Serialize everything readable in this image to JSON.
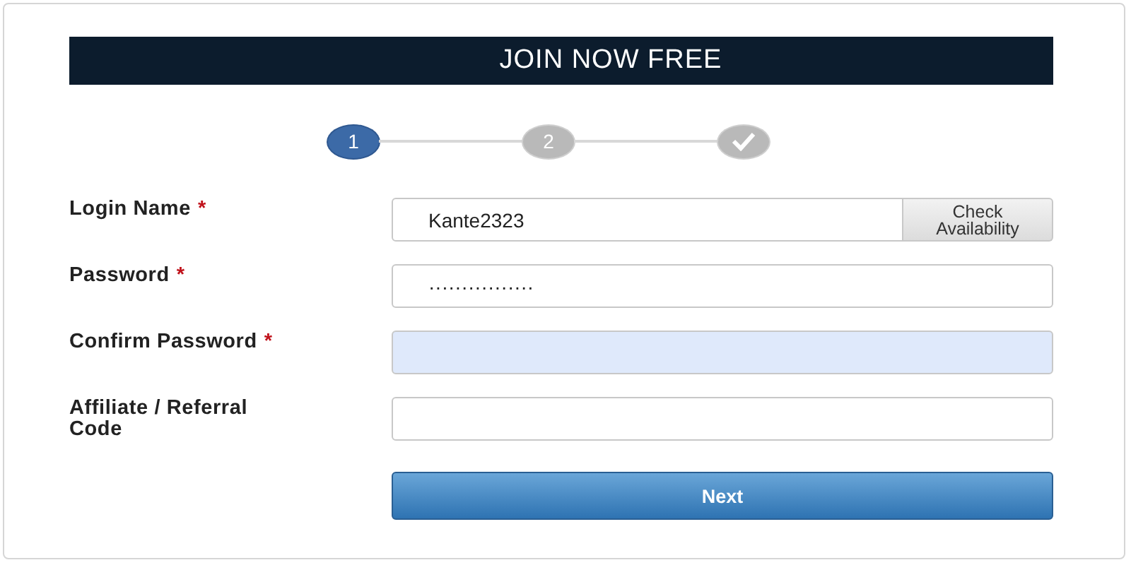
{
  "header": {
    "title": "JOIN NOW FREE"
  },
  "steps": [
    {
      "kind": "number",
      "label": "1",
      "selected": true
    },
    {
      "kind": "number",
      "label": "2",
      "selected": false
    },
    {
      "kind": "check",
      "selected": false
    }
  ],
  "fields": [
    {
      "label": "Login Name",
      "required_mark": "*",
      "value": "Kante2323",
      "autofilled": false,
      "action": "Check Availability"
    },
    {
      "label": "Password",
      "required_mark": "*",
      "value": "················",
      "autofilled": false
    },
    {
      "label": "Confirm Password",
      "required_mark": "*",
      "autofilled": true
    },
    {
      "label": "Affiliate / Referral Code",
      "autofilled": false
    }
  ],
  "submit": "Next"
}
